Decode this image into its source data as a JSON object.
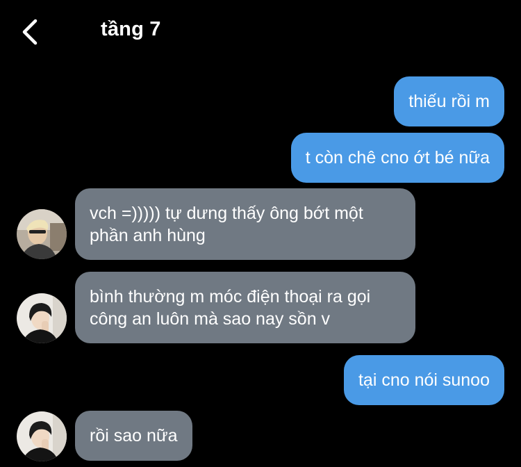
{
  "header": {
    "title": "tầng 7",
    "back_icon": "chevron-left-icon"
  },
  "colors": {
    "background": "#000000",
    "outgoing_bubble": "#4a9ae6",
    "incoming_bubble": "#707983",
    "text": "#ffffff"
  },
  "messages": [
    {
      "direction": "outgoing",
      "text": "thiếu rồi m"
    },
    {
      "direction": "outgoing",
      "text": "t còn chê cno ớt bé nữa"
    },
    {
      "direction": "incoming",
      "avatar": "avatar-blond",
      "lines": [
        "vch =))))) tự dưng thấy ông bớt một",
        "phần anh hùng"
      ]
    },
    {
      "direction": "incoming",
      "avatar": "avatar-dark-hair",
      "lines": [
        "bình thường m móc điện thoại ra gọi",
        "công an luôn mà sao nay sồn v"
      ]
    },
    {
      "direction": "outgoing",
      "text": "tại cno nói sunoo"
    },
    {
      "direction": "incoming",
      "avatar": "avatar-dark-hair",
      "text": "rồi sao nữa"
    }
  ]
}
